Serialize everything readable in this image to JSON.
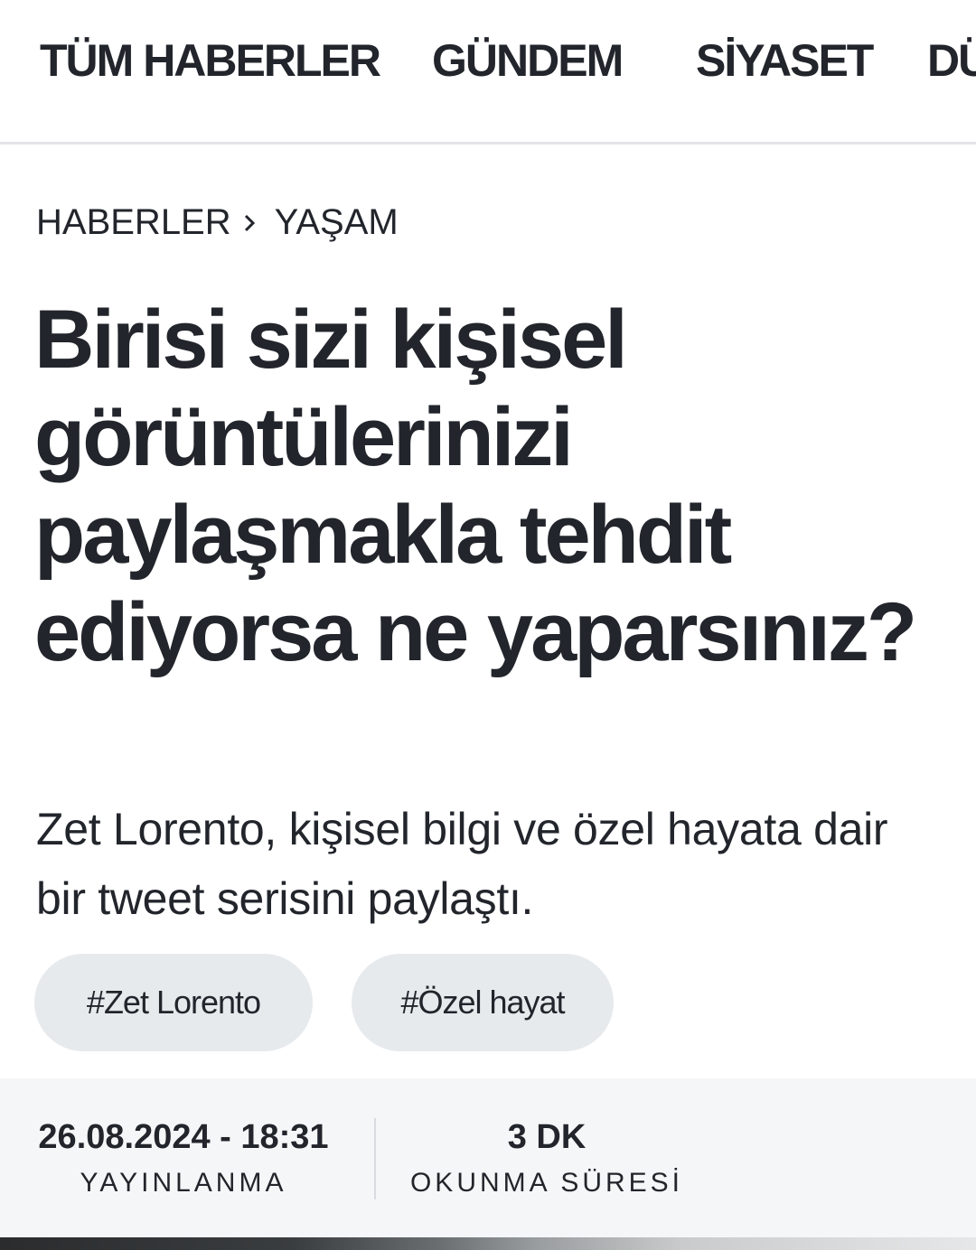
{
  "nav": {
    "items": [
      "TÜM HABERLER",
      "GÜNDEM",
      "SİYASET",
      "DÜ"
    ]
  },
  "breadcrumb": {
    "items": [
      "HABERLER",
      "YAŞAM"
    ],
    "separator_icon": "chevron-right-icon"
  },
  "article": {
    "title": "Birisi sizi kişisel görüntülerinizi paylaşmakla tehdit ediyorsa ne yaparsınız?",
    "summary": "Zet Lorento, kişisel bilgi ve özel hayata dair bir tweet serisini paylaştı.",
    "tags": [
      "#Zet Lorento",
      "#Özel hayat"
    ]
  },
  "meta": {
    "published_value": "26.08.2024 - 18:31",
    "published_label": "YAYINLANMA",
    "read_time_value": "3 DK",
    "read_time_label": "OKUNMA SÜRESİ"
  },
  "colors": {
    "text": "#22252b",
    "tag_bg": "#e7eaed",
    "meta_bg": "#f5f6f7",
    "divider": "#e2e4e7"
  }
}
